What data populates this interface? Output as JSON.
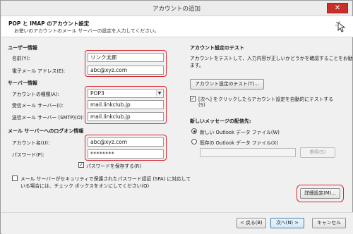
{
  "window": {
    "title": "アカウントの追加",
    "close_glyph": "✕"
  },
  "header": {
    "title": "POP と IMAP のアカウント設定",
    "subtitle": "お使いのアカウントのメール サーバーの設定を入力してください。"
  },
  "user_info": {
    "section": "ユーザー情報",
    "name_label": "名前(Y):",
    "name_value": "リンク太郎",
    "email_label": "電子メール アドレス(E):",
    "email_value": "abc@xyz.com"
  },
  "server_info": {
    "section": "サーバー情報",
    "account_type_label": "アカウントの種類(A):",
    "account_type_value": "POP3",
    "incoming_label": "受信メール サーバー(I):",
    "incoming_value": "mail.linkclub.jp",
    "outgoing_label": "送信メール サーバー (SMTP)(O):",
    "outgoing_value": "mail.linkclub.jp"
  },
  "logon_info": {
    "section": "メール サーバーへのログオン情報",
    "account_name_label": "アカウント名(U):",
    "account_name_value": "abc@xyz.com",
    "password_label": "パスワード(P):",
    "password_value": "********",
    "save_password_label": "パスワードを保存する(R)",
    "save_password_checked": "✓",
    "spa_label_line1": "メール サーバーがセキュリティで保護されたパスワード認証 (SPA) に対応して",
    "spa_label_line2": "いる場合には、チェック ボックスをオンにしてください(Q)"
  },
  "test": {
    "section": "アカウント設定のテスト",
    "desc_line1": "アカウントをテストして、入力内容が正しいかどうかを確認することをお勧めし",
    "desc_line2": "ます。",
    "test_button": "アカウント設定のテスト(T)...",
    "auto_test_line1": "[次へ] をクリックしたらアカウント設定を自動的にテストする",
    "auto_test_line2": "(S)",
    "auto_test_checked": "✓"
  },
  "delivery": {
    "section": "新しいメッセージの配信先:",
    "option_new": "新しい Outlook データ ファイル(W)",
    "option_existing": "既存の Outlook データ ファイル(X)",
    "browse_button": "参照(S)"
  },
  "more_settings_button": "詳細設定(M)...",
  "footer": {
    "back_button": "< 戻る(B)",
    "next_button": "次へ(N) >",
    "cancel_button": "キャンセル"
  },
  "colors": {
    "highlight": "#d8262b",
    "primary_border": "#3c7fb1"
  }
}
